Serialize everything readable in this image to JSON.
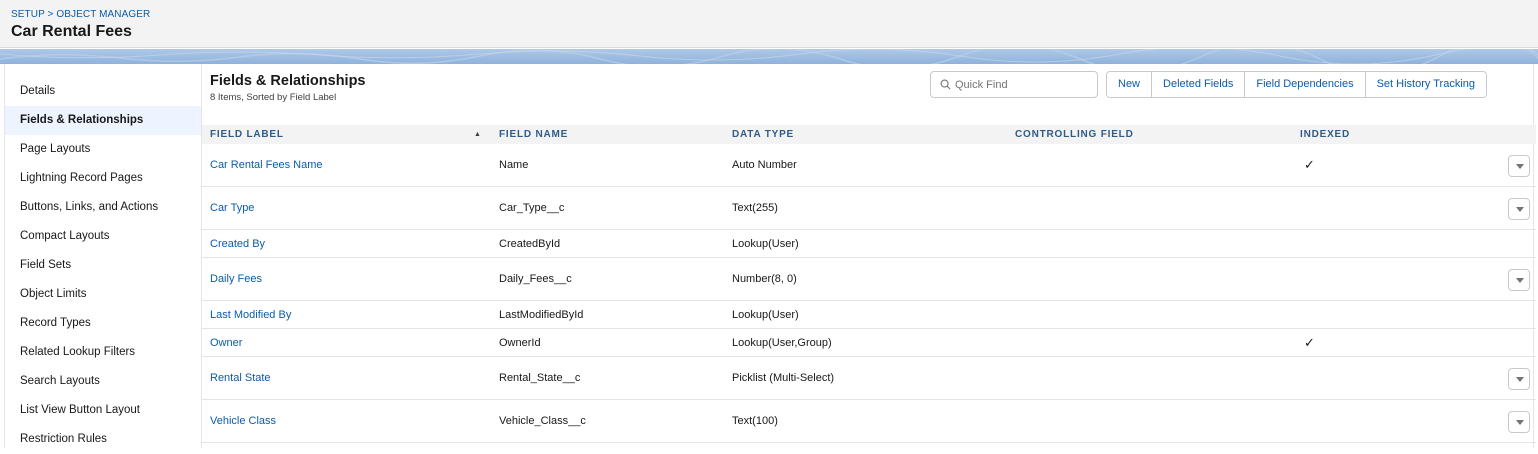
{
  "header": {
    "breadcrumb": "SETUP > OBJECT MANAGER",
    "title": "Car Rental Fees"
  },
  "sidebar": {
    "items": [
      {
        "label": "Details",
        "active": false
      },
      {
        "label": "Fields & Relationships",
        "active": true
      },
      {
        "label": "Page Layouts",
        "active": false
      },
      {
        "label": "Lightning Record Pages",
        "active": false
      },
      {
        "label": "Buttons, Links, and Actions",
        "active": false
      },
      {
        "label": "Compact Layouts",
        "active": false
      },
      {
        "label": "Field Sets",
        "active": false
      },
      {
        "label": "Object Limits",
        "active": false
      },
      {
        "label": "Record Types",
        "active": false
      },
      {
        "label": "Related Lookup Filters",
        "active": false
      },
      {
        "label": "Search Layouts",
        "active": false
      },
      {
        "label": "List View Button Layout",
        "active": false
      },
      {
        "label": "Restriction Rules",
        "active": false
      }
    ]
  },
  "main": {
    "title": "Fields & Relationships",
    "subtitle": "8 Items, Sorted by Field Label",
    "search_placeholder": "Quick Find",
    "buttons": [
      "New",
      "Deleted Fields",
      "Field Dependencies",
      "Set History Tracking"
    ],
    "columns": [
      "FIELD LABEL",
      "FIELD NAME",
      "DATA TYPE",
      "CONTROLLING FIELD",
      "INDEXED"
    ],
    "sort_indicator": "▲",
    "rows": [
      {
        "label": "Car Rental Fees Name",
        "name": "Name",
        "type": "Auto Number",
        "controlling": "",
        "indexed": true,
        "menu": true
      },
      {
        "label": "Car Type",
        "name": "Car_Type__c",
        "type": "Text(255)",
        "controlling": "",
        "indexed": false,
        "menu": true
      },
      {
        "label": "Created By",
        "name": "CreatedById",
        "type": "Lookup(User)",
        "controlling": "",
        "indexed": false,
        "menu": false
      },
      {
        "label": "Daily Fees",
        "name": "Daily_Fees__c",
        "type": "Number(8, 0)",
        "controlling": "",
        "indexed": false,
        "menu": true
      },
      {
        "label": "Last Modified By",
        "name": "LastModifiedById",
        "type": "Lookup(User)",
        "controlling": "",
        "indexed": false,
        "menu": false
      },
      {
        "label": "Owner",
        "name": "OwnerId",
        "type": "Lookup(User,Group)",
        "controlling": "",
        "indexed": true,
        "menu": false
      },
      {
        "label": "Rental State",
        "name": "Rental_State__c",
        "type": "Picklist (Multi-Select)",
        "controlling": "",
        "indexed": false,
        "menu": true
      },
      {
        "label": "Vehicle Class",
        "name": "Vehicle_Class__c",
        "type": "Text(100)",
        "controlling": "",
        "indexed": false,
        "menu": true
      }
    ],
    "check_glyph": "✓"
  },
  "colors": {
    "link": "#0b5cab",
    "header_bg": "#f3f3f3",
    "band": "#8fb2dc",
    "active_item_bg": "#eef4ff"
  },
  "icons": {
    "search": "search-icon",
    "row_menu": "chevron-down-icon"
  }
}
